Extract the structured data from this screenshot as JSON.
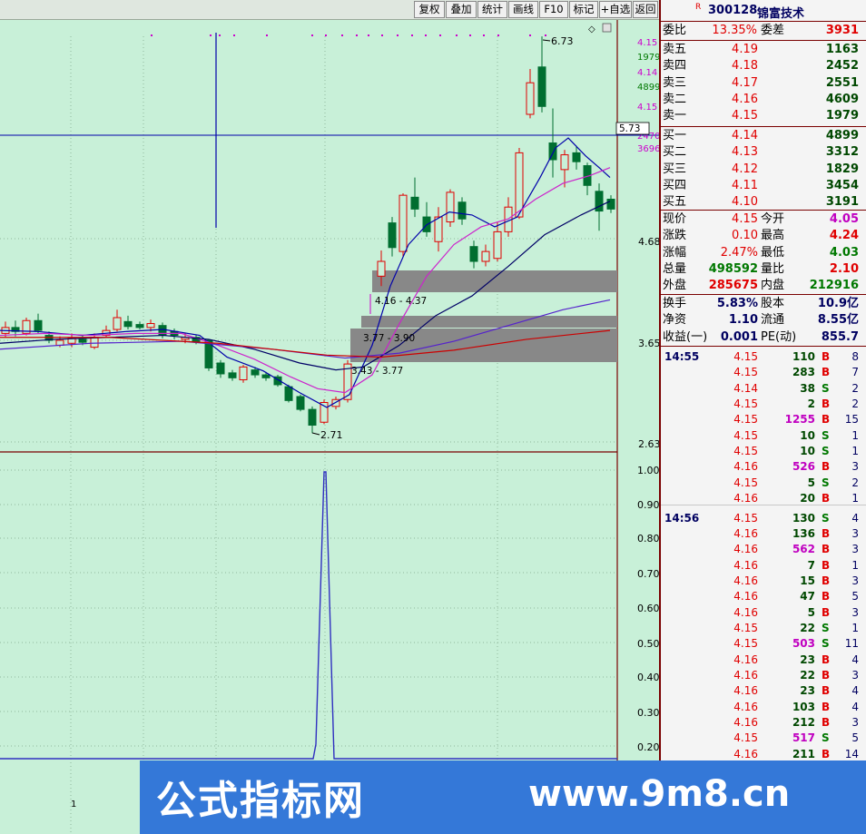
{
  "toolbar": {
    "buttons": [
      "复权",
      "叠加",
      "统计",
      "画线",
      "F10",
      "标记",
      "+自选",
      "返回"
    ]
  },
  "chart": {
    "price_axis": [
      "4.68",
      "3.65",
      "2.63"
    ],
    "right_stack": [
      "4.15",
      "1979",
      "4.14",
      "4899",
      "4.15",
      "4.14",
      "2470",
      "3696"
    ],
    "price_marker": "5.73",
    "annotations": {
      "high": "6.73",
      "low": "2.71",
      "z1": "4.16 - 4.37",
      "z2": "3.77 - 3.90",
      "z3": "3.43 - 3.77"
    },
    "ind_axis": [
      "1.00",
      "0.90",
      "0.80",
      "0.70",
      "0.60",
      "0.50",
      "0.40",
      "0.30",
      "0.20"
    ],
    "bottom_tick": "1",
    "colors": {
      "bg": "#c8f0d8",
      "up": "#e00000",
      "down": "#006e30",
      "ma5": "#0000aa",
      "ma10": "#cc22cc",
      "ma20": "#000066",
      "ma60": "#5522cc",
      "ma120": "#cc0000"
    }
  },
  "quote": {
    "flag": "R",
    "code": "300128",
    "name": "锦富技术",
    "weibi_label": "委比",
    "weibi": "13.35%",
    "weicha_label": "委差",
    "weicha": "3931",
    "asks": [
      {
        "label": "卖五",
        "price": "4.19",
        "vol": "1163"
      },
      {
        "label": "卖四",
        "price": "4.18",
        "vol": "2452"
      },
      {
        "label": "卖三",
        "price": "4.17",
        "vol": "2551"
      },
      {
        "label": "卖二",
        "price": "4.16",
        "vol": "4609"
      },
      {
        "label": "卖一",
        "price": "4.15",
        "vol": "1979"
      }
    ],
    "bids": [
      {
        "label": "买一",
        "price": "4.14",
        "vol": "4899"
      },
      {
        "label": "买二",
        "price": "4.13",
        "vol": "3312"
      },
      {
        "label": "买三",
        "price": "4.12",
        "vol": "1829"
      },
      {
        "label": "买四",
        "price": "4.11",
        "vol": "3454"
      },
      {
        "label": "买五",
        "price": "4.10",
        "vol": "3191"
      }
    ],
    "stats": [
      {
        "l1": "现价",
        "v1": "4.15",
        "c1": "red",
        "l2": "今开",
        "v2": "4.05",
        "c2": "mag"
      },
      {
        "l1": "涨跌",
        "v1": "0.10",
        "c1": "red",
        "l2": "最高",
        "v2": "4.24",
        "c2": "red"
      },
      {
        "l1": "涨幅",
        "v1": "2.47%",
        "c1": "red",
        "l2": "最低",
        "v2": "4.03",
        "c2": "grn"
      },
      {
        "l1": "总量",
        "v1": "498592",
        "c1": "grn",
        "l2": "量比",
        "v2": "2.10",
        "c2": "red"
      },
      {
        "l1": "外盘",
        "v1": "285675",
        "c1": "red",
        "l2": "内盘",
        "v2": "212916",
        "c2": "grn"
      }
    ],
    "stats2": [
      {
        "l1": "换手",
        "v1": "5.83%",
        "l2": "股本",
        "v2": "10.9亿"
      },
      {
        "l1": "净资",
        "v1": "1.10",
        "l2": "流通",
        "v2": "8.55亿"
      },
      {
        "l1": "收益(一)",
        "v1": "0.001",
        "l2": "PE(动)",
        "v2": "855.7"
      }
    ],
    "ticks": [
      {
        "time": "14:55",
        "price": "4.15",
        "vol": "110",
        "side": "B",
        "n": "8"
      },
      {
        "time": "",
        "price": "4.15",
        "vol": "283",
        "side": "B",
        "n": "7"
      },
      {
        "time": "",
        "price": "4.14",
        "vol": "38",
        "side": "S",
        "n": "2"
      },
      {
        "time": "",
        "price": "4.15",
        "vol": "2",
        "side": "B",
        "n": "2"
      },
      {
        "time": "",
        "price": "4.15",
        "vol": "1255",
        "side": "B",
        "n": "15"
      },
      {
        "time": "",
        "price": "4.15",
        "vol": "10",
        "side": "S",
        "n": "1"
      },
      {
        "time": "",
        "price": "4.15",
        "vol": "10",
        "side": "S",
        "n": "1"
      },
      {
        "time": "",
        "price": "4.16",
        "vol": "526",
        "side": "B",
        "n": "3"
      },
      {
        "time": "",
        "price": "4.15",
        "vol": "5",
        "side": "S",
        "n": "2"
      },
      {
        "time": "",
        "price": "4.16",
        "vol": "20",
        "side": "B",
        "n": "1"
      },
      {
        "time": "14:56",
        "price": "4.15",
        "vol": "130",
        "side": "S",
        "n": "4"
      },
      {
        "time": "",
        "price": "4.16",
        "vol": "136",
        "side": "B",
        "n": "3"
      },
      {
        "time": "",
        "price": "4.16",
        "vol": "562",
        "side": "B",
        "n": "3"
      },
      {
        "time": "",
        "price": "4.16",
        "vol": "7",
        "side": "B",
        "n": "1"
      },
      {
        "time": "",
        "price": "4.16",
        "vol": "15",
        "side": "B",
        "n": "3"
      },
      {
        "time": "",
        "price": "4.16",
        "vol": "47",
        "side": "B",
        "n": "5"
      },
      {
        "time": "",
        "price": "4.16",
        "vol": "5",
        "side": "B",
        "n": "3"
      },
      {
        "time": "",
        "price": "4.15",
        "vol": "22",
        "side": "S",
        "n": "1"
      },
      {
        "time": "",
        "price": "4.15",
        "vol": "503",
        "side": "S",
        "n": "11"
      },
      {
        "time": "",
        "price": "4.16",
        "vol": "23",
        "side": "B",
        "n": "4"
      },
      {
        "time": "",
        "price": "4.16",
        "vol": "22",
        "side": "B",
        "n": "3"
      },
      {
        "time": "",
        "price": "4.16",
        "vol": "23",
        "side": "B",
        "n": "4"
      },
      {
        "time": "",
        "price": "4.16",
        "vol": "103",
        "side": "B",
        "n": "4"
      },
      {
        "time": "",
        "price": "4.16",
        "vol": "212",
        "side": "B",
        "n": "3"
      },
      {
        "time": "",
        "price": "4.15",
        "vol": "517",
        "side": "S",
        "n": "5"
      },
      {
        "time": "",
        "price": "4.16",
        "vol": "211",
        "side": "B",
        "n": "14"
      }
    ]
  },
  "watermark": {
    "text1": "公式指标网",
    "text2": "www.9m8.cn"
  }
}
